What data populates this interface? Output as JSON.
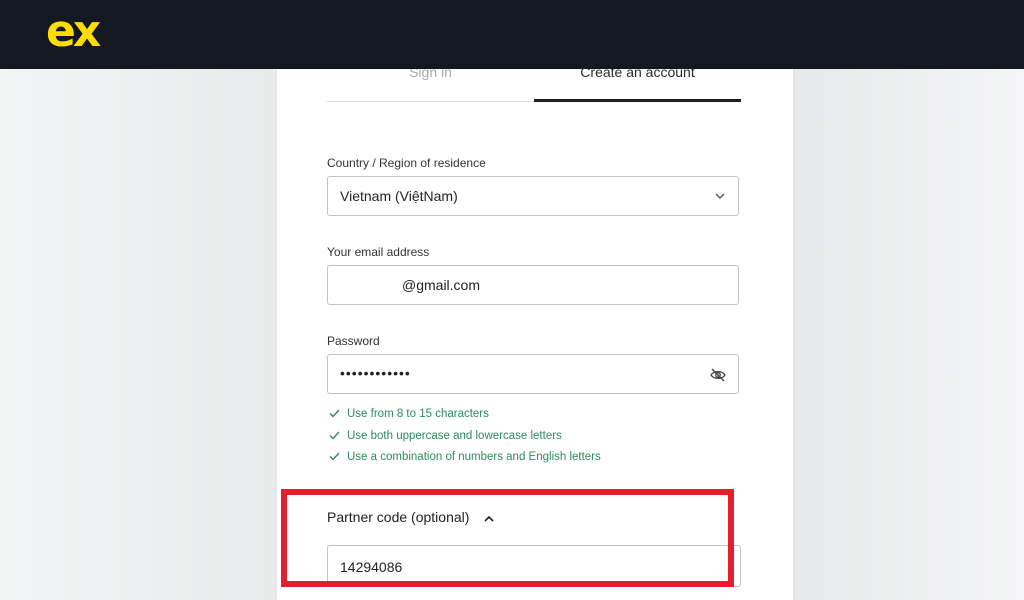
{
  "brand": {
    "logo_text": "ex",
    "logo_color": "#ffdd00",
    "topbar_color": "#141820"
  },
  "tabs": [
    {
      "label": "Sign in",
      "active": false
    },
    {
      "label": "Create an account",
      "active": true
    }
  ],
  "form": {
    "country": {
      "label": "Country / Region of residence",
      "value": "Vietnam (ViệtNam)"
    },
    "email": {
      "label": "Your email address",
      "value": "@gmail.com"
    },
    "password": {
      "label": "Password",
      "value": "••••••••••••",
      "visibility_icon": "eye-off-icon"
    },
    "password_rules": [
      "Use from 8 to 15 characters",
      "Use both uppercase and lowercase letters",
      "Use a combination of numbers and English letters"
    ],
    "partner_code": {
      "label": "Partner code (optional)",
      "value": "14294086",
      "expanded": true
    }
  },
  "colors": {
    "rule_ok": "#2e8a5e",
    "highlight": "#e21f2a"
  }
}
